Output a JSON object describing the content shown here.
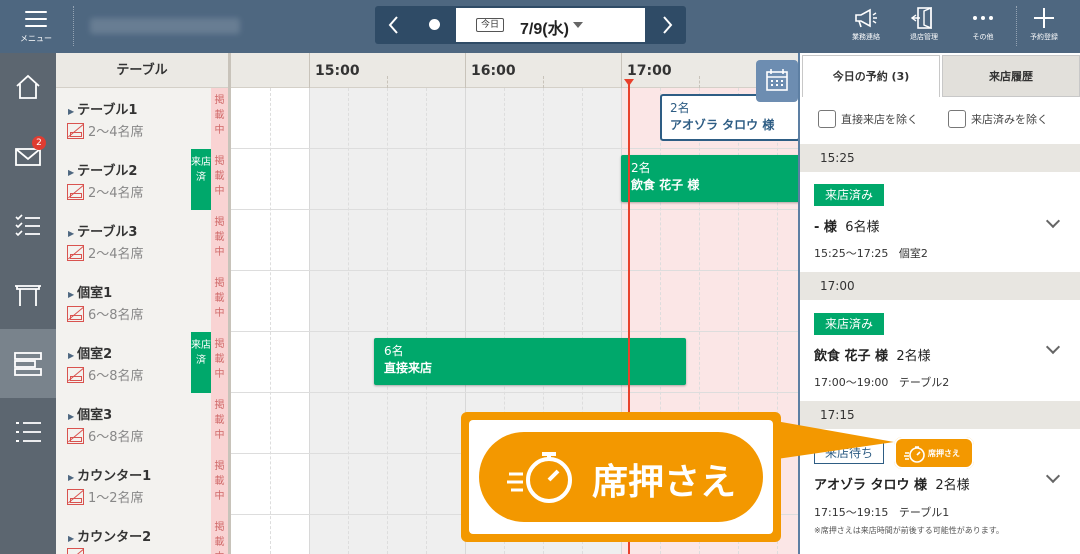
{
  "header": {
    "menu_label": "メニュー",
    "store_name": "",
    "today_chip": "今日",
    "date": "7/9(水)",
    "actions": [
      {
        "label": "業務連絡",
        "icon": "megaphone-icon"
      },
      {
        "label": "退店管理",
        "icon": "exit-door-icon"
      },
      {
        "label": "その他",
        "icon": "more-dots-icon"
      },
      {
        "label": "予約登録",
        "icon": "plus-icon"
      }
    ]
  },
  "sidebar": {
    "items": [
      {
        "icon": "home-icon"
      },
      {
        "icon": "mail-icon",
        "badge": "2"
      },
      {
        "icon": "checklist-icon"
      },
      {
        "icon": "table-icon"
      },
      {
        "icon": "timeline-icon",
        "active": true
      },
      {
        "icon": "list-icon"
      }
    ]
  },
  "timeline": {
    "table_header": "テーブル",
    "times": [
      "15:00",
      "16:00",
      "17:00"
    ],
    "listing_text": "掲載中",
    "arrived_text": "来店済",
    "rows": [
      {
        "name": "テーブル1",
        "capacity": "2～4名席",
        "arrived": false
      },
      {
        "name": "テーブル2",
        "capacity": "2～4名席",
        "arrived": true
      },
      {
        "name": "テーブル3",
        "capacity": "2～4名席",
        "arrived": false
      },
      {
        "name": "個室1",
        "capacity": "6～8名席",
        "arrived": false
      },
      {
        "name": "個室2",
        "capacity": "6～8名席",
        "arrived": true
      },
      {
        "name": "個室3",
        "capacity": "6～8名席",
        "arrived": false
      },
      {
        "name": "カウンター1",
        "capacity": "1～2名席",
        "arrived": false
      },
      {
        "name": "カウンター2",
        "capacity": "",
        "arrived": false
      }
    ],
    "reservations": [
      {
        "count": "2名",
        "name": "アオゾラ タロウ 様"
      },
      {
        "count": "2名",
        "name": "飲食 花子 様"
      },
      {
        "count": "6名",
        "name": "直接来店"
      }
    ]
  },
  "right_panel": {
    "tabs": [
      "今日の予約 (3)",
      "来店履歴"
    ],
    "filters": [
      "直接来店を除く",
      "来店済みを除く"
    ],
    "sections": [
      {
        "time": "15:25",
        "status": "来店済み",
        "guest": "- 様",
        "party": "6名様",
        "slot": "15:25～17:25",
        "table": "個室2"
      },
      {
        "time": "17:00",
        "status": "来店済み",
        "guest": "飲食 花子 様",
        "party": "2名様",
        "slot": "17:00～19:00",
        "table": "テーブル2"
      },
      {
        "time": "17:15",
        "status": "来店待ち",
        "guest": "アオゾラ タロウ 様",
        "party": "2名様",
        "slot": "17:15～19:15",
        "table": "テーブル1",
        "hold": "席押さえ"
      }
    ],
    "note": "※席押さえは来店時間が前後する可能性があります。"
  },
  "callout": {
    "text": "席押さえ"
  },
  "colors": {
    "topbar": "#4e6780",
    "accent_green": "#00a86b",
    "hold_orange": "#f39800",
    "now_line": "#e8412c"
  }
}
